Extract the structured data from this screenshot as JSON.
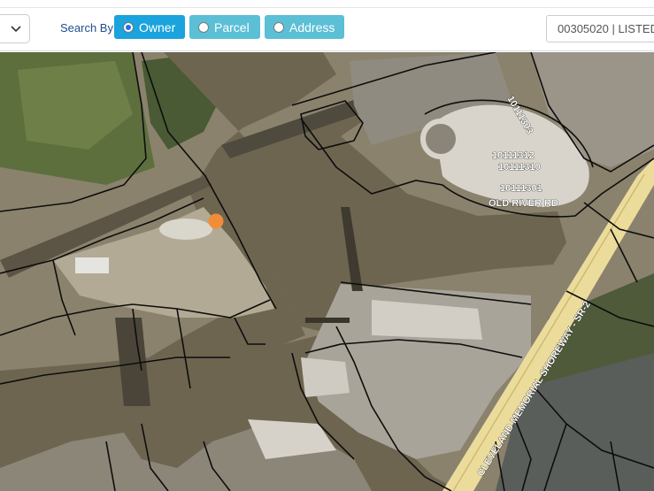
{
  "toolbar": {
    "search_by_label": "Search By",
    "options": [
      {
        "label": "Owner",
        "selected": true
      },
      {
        "label": "Parcel",
        "selected": false
      },
      {
        "label": "Address",
        "selected": false
      }
    ],
    "parcel_display_value": "00305020 | LISTED",
    "colors": {
      "selected": "#1aa3dc",
      "unselected": "#5bbfd6"
    }
  },
  "map": {
    "parcel_labels": [
      "10111303",
      "10111312",
      "10111310",
      "10111301"
    ],
    "street_label": "OLD RIVER RD",
    "shoreway_label": "CLEVELAND MEMORIAL SHOREWAY - SR-2",
    "marker_color": "#f28c38"
  }
}
